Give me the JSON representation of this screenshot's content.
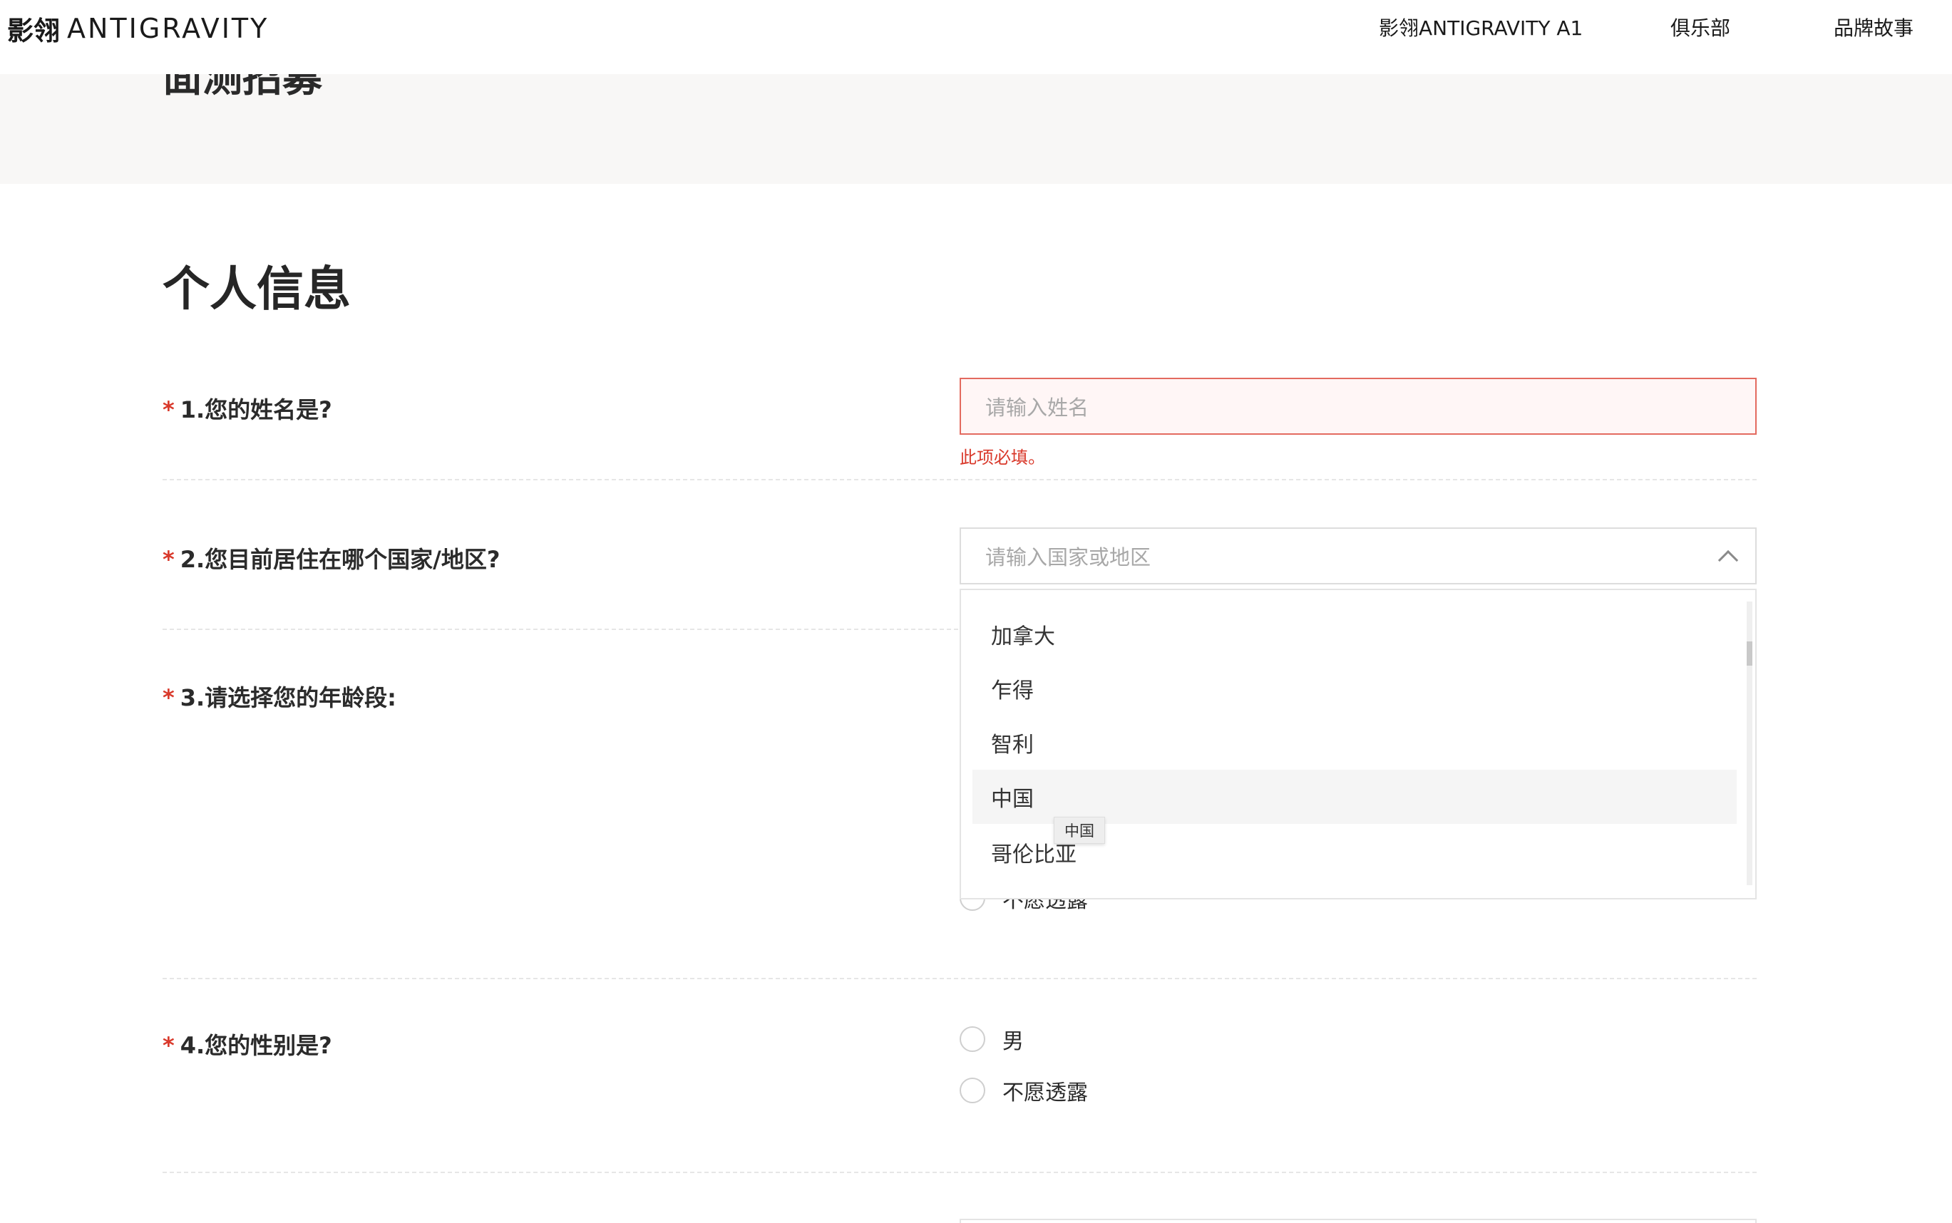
{
  "nav": {
    "brand_cn": "影翎",
    "brand_en": "ANTIGRAVITY",
    "links": [
      "影翎ANTIGRAVITY A1",
      "俱乐部",
      "品牌故事"
    ]
  },
  "hero": {
    "title": "面测招募"
  },
  "section": {
    "title": "个人信息"
  },
  "questions": [
    {
      "req": "*",
      "label": "1.您的姓名是?"
    },
    {
      "req": "*",
      "label": "2.您目前居住在哪个国家/地区?"
    },
    {
      "req": "*",
      "label": "3.请选择您的年龄段:"
    },
    {
      "req": "*",
      "label": "4.您的性别是?"
    }
  ],
  "name_field": {
    "placeholder": "请输入姓名",
    "error": "此项必填。"
  },
  "country_field": {
    "placeholder": "请输入国家或地区"
  },
  "country_options": [
    "加拿大",
    "乍得",
    "智利",
    "中国",
    "哥伦比亚"
  ],
  "hovered_option": "中国",
  "tooltip": "中国",
  "age_partial_option": "不愿透露",
  "gender_options": [
    "男",
    "不愿透露"
  ]
}
